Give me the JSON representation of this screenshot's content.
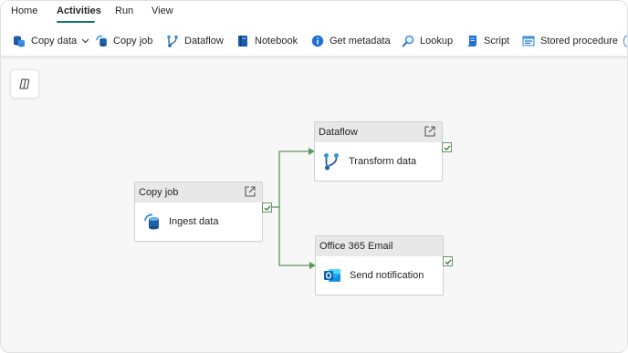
{
  "menu": {
    "items": [
      {
        "label": "Home"
      },
      {
        "label": "Activities"
      },
      {
        "label": "Run"
      },
      {
        "label": "View"
      }
    ]
  },
  "toolbar": {
    "items": [
      {
        "label": "Copy data",
        "icon": "copy-data-icon"
      },
      {
        "label": "Copy job",
        "icon": "copy-job-icon"
      },
      {
        "label": "Dataflow",
        "icon": "dataflow-icon"
      },
      {
        "label": "Notebook",
        "icon": "notebook-icon"
      },
      {
        "label": "Get metadata",
        "icon": "info-icon"
      },
      {
        "label": "Lookup",
        "icon": "search-icon"
      },
      {
        "label": "Script",
        "icon": "script-icon"
      },
      {
        "label": "Stored procedure",
        "icon": "stored-procedure-icon"
      }
    ]
  },
  "nodes": {
    "copyjob": {
      "type": "Copy job",
      "name": "Ingest data"
    },
    "dataflow": {
      "type": "Dataflow",
      "name": "Transform data"
    },
    "email": {
      "type": "Office 365 Email",
      "name": "Send notification"
    }
  },
  "colors": {
    "accent": "#117865",
    "connector": "#5a9a5a",
    "header": "#e8e8e8"
  }
}
